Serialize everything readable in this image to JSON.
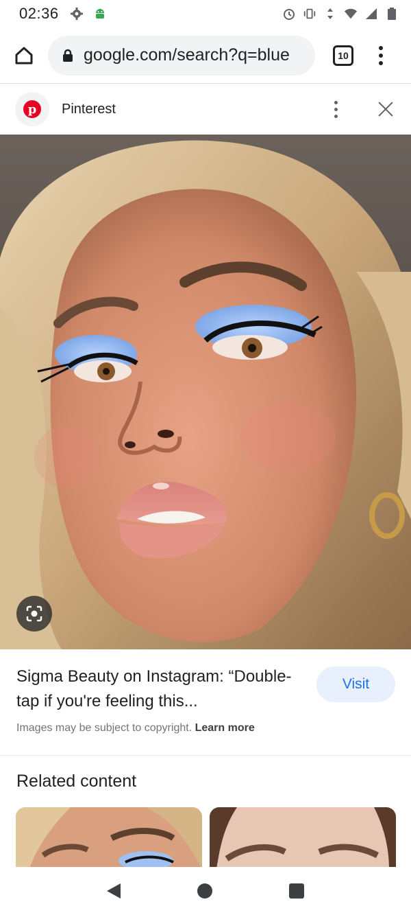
{
  "status_bar": {
    "time": "02:36",
    "left_icons": [
      "settings-icon",
      "android-debug-icon"
    ],
    "right_icons": [
      "alarm-icon",
      "vibrate-icon",
      "data-arrows-icon",
      "wifi-icon",
      "signal-icon",
      "battery-icon"
    ]
  },
  "browser": {
    "url": "google.com/search?q=blue",
    "tab_count": "10"
  },
  "source": {
    "name": "Pinterest",
    "logo_letter": "p"
  },
  "result": {
    "title": "Sigma Beauty on Instagram: “Double-tap if you're feeling this...",
    "visit_label": "Visit",
    "copyright_text": "Images may be subject to copyright.",
    "learn_more_label": "Learn more"
  },
  "related": {
    "heading": "Related content"
  },
  "colors": {
    "accent": "#1a73e8",
    "visit_bg": "#e8f0fe",
    "pinterest_red": "#e60023"
  }
}
